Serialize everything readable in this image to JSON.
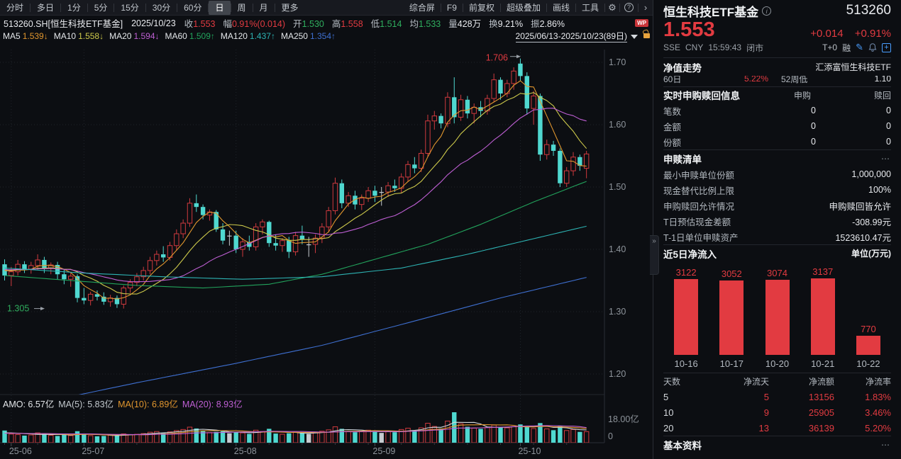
{
  "accent_colors": {
    "red": "#e23b41",
    "green": "#2fae5e",
    "cyan": "#4fd8d0",
    "candle_red": "#cf3a3e",
    "white": "#e8eaee",
    "gray": "#9aa0a7"
  },
  "toolbar": {
    "tabs": [
      {
        "label": "分时",
        "active": false
      },
      {
        "label": "多日",
        "active": false
      },
      {
        "label": "1分",
        "active": false
      },
      {
        "label": "5分",
        "active": false
      },
      {
        "label": "15分",
        "active": false
      },
      {
        "label": "30分",
        "active": false
      },
      {
        "label": "60分",
        "active": false
      },
      {
        "label": "日",
        "active": true
      },
      {
        "label": "周",
        "active": false
      },
      {
        "label": "月",
        "active": false
      },
      {
        "label": "更多",
        "active": false
      }
    ],
    "tools": [
      "综合屏",
      "F9",
      "前复权",
      "超级叠加",
      "画线",
      "工具"
    ],
    "gear_icon": "⚙",
    "help_icon": "?",
    "chevron_icon": "›"
  },
  "info_bar": {
    "symbol": "513260.SH[恒生科技ETF基金]",
    "date": "2025/10/23",
    "fields": [
      {
        "label": "收",
        "value": "1.553",
        "color": "red"
      },
      {
        "label": "幅",
        "value": "0.91%(0.014)",
        "color": "red"
      },
      {
        "label": "开",
        "value": "1.530",
        "color": "green"
      },
      {
        "label": "高",
        "value": "1.558",
        "color": "red"
      },
      {
        "label": "低",
        "value": "1.514",
        "color": "green"
      },
      {
        "label": "均",
        "value": "1.533",
        "color": "green"
      },
      {
        "label": "量",
        "value": "428万",
        "color": "white"
      },
      {
        "label": "换",
        "value": "9.21%",
        "color": "white"
      },
      {
        "label": "振",
        "value": "2.86%",
        "color": "white"
      }
    ],
    "wp_badge": "WP"
  },
  "ma_legend": [
    {
      "name": "MA5",
      "value": "1.539",
      "arrow": "↓",
      "color": "#e0962e"
    },
    {
      "name": "MA10",
      "value": "1.558",
      "arrow": "↓",
      "color": "#cdc94b"
    },
    {
      "name": "MA20",
      "value": "1.594",
      "arrow": "↓",
      "color": "#bf5fd4"
    },
    {
      "name": "MA60",
      "value": "1.509",
      "arrow": "↑",
      "color": "#22a35c"
    },
    {
      "name": "MA120",
      "value": "1.437",
      "arrow": "↑",
      "color": "#2db3b3"
    },
    {
      "name": "MA250",
      "value": "1.354",
      "arrow": "↑",
      "color": "#3e6fd0"
    }
  ],
  "range_label": "2025/06/13-2025/10/23(89日)",
  "volume_legend": [
    {
      "text": "AMO: 6.57亿",
      "color": "#e4e7ea"
    },
    {
      "text": "MA(5): 5.83亿",
      "color": "#c3c9ce"
    },
    {
      "text": "MA(10): 6.89亿",
      "color": "#e0962e"
    },
    {
      "text": "MA(20): 8.93亿",
      "color": "#bf5fd4"
    }
  ],
  "chart_data": {
    "type": "candlestick_volume",
    "title": "513260.SH 恒生科技ETF基金 日K 2025/06/13-2025/10/23",
    "y_ticks": [
      "1.70",
      "1.60",
      "1.50",
      "1.40",
      "1.30",
      "1.20"
    ],
    "x_ticks": [
      {
        "label": "25-06",
        "i": 1
      },
      {
        "label": "25-07",
        "i": 12
      },
      {
        "label": "25-08",
        "i": 35
      },
      {
        "label": "25-09",
        "i": 56
      },
      {
        "label": "25-10",
        "i": 78
      }
    ],
    "vol_axis": {
      "top": "18.00亿",
      "zero": "0",
      "max": 18
    },
    "annotations": {
      "high_label": "1.706",
      "high_value": 1.706,
      "low_label": "1.305",
      "low_value": 1.305
    },
    "ma_short": [
      {
        "n": 5,
        "color": "#e0962e"
      },
      {
        "n": 10,
        "color": "#cdc94b"
      },
      {
        "n": 20,
        "color": "#bf5fd4"
      }
    ],
    "ma_long": [
      {
        "name": "MA60",
        "color": "#22a35c",
        "points": [
          [
            0,
            1.358
          ],
          [
            10,
            1.35
          ],
          [
            20,
            1.342
          ],
          [
            30,
            1.338
          ],
          [
            40,
            1.344
          ],
          [
            48,
            1.36
          ],
          [
            56,
            1.384
          ],
          [
            64,
            1.408
          ],
          [
            72,
            1.44
          ],
          [
            80,
            1.476
          ],
          [
            88,
            1.509
          ]
        ]
      },
      {
        "name": "MA120",
        "color": "#2db3b3",
        "points": [
          [
            0,
            1.37
          ],
          [
            12,
            1.362
          ],
          [
            24,
            1.356
          ],
          [
            36,
            1.352
          ],
          [
            48,
            1.356
          ],
          [
            60,
            1.37
          ],
          [
            70,
            1.392
          ],
          [
            78,
            1.412
          ],
          [
            88,
            1.437
          ]
        ]
      },
      {
        "name": "MA250",
        "color": "#3e6fd0",
        "points": [
          [
            6,
            1.155
          ],
          [
            20,
            1.186
          ],
          [
            34,
            1.215
          ],
          [
            48,
            1.246
          ],
          [
            62,
            1.285
          ],
          [
            75,
            1.322
          ],
          [
            88,
            1.355
          ]
        ]
      }
    ],
    "vol_ma": [
      {
        "n": 5,
        "color": "#d3d7db"
      },
      {
        "n": 10,
        "color": "#e0962e"
      },
      {
        "n": 20,
        "color": "#bf5fd4"
      }
    ],
    "candles": [
      [
        1.376,
        1.384,
        1.35,
        1.358
      ],
      [
        1.358,
        1.372,
        1.341,
        1.364
      ],
      [
        1.364,
        1.383,
        1.358,
        1.376
      ],
      [
        1.376,
        1.381,
        1.362,
        1.368
      ],
      [
        1.368,
        1.38,
        1.361,
        1.374
      ],
      [
        1.374,
        1.392,
        1.367,
        1.383
      ],
      [
        1.383,
        1.388,
        1.362,
        1.37
      ],
      [
        1.37,
        1.379,
        1.36,
        1.375
      ],
      [
        1.375,
        1.38,
        1.352,
        1.36
      ],
      [
        1.36,
        1.368,
        1.344,
        1.352
      ],
      [
        1.352,
        1.362,
        1.34,
        1.357
      ],
      [
        1.357,
        1.36,
        1.315,
        1.322
      ],
      [
        1.322,
        1.338,
        1.312,
        1.318
      ],
      [
        1.318,
        1.332,
        1.31,
        1.328
      ],
      [
        1.328,
        1.334,
        1.318,
        1.324
      ],
      [
        1.324,
        1.331,
        1.311,
        1.316
      ],
      [
        1.316,
        1.327,
        1.308,
        1.322
      ],
      [
        1.322,
        1.326,
        1.306,
        1.312
      ],
      [
        1.312,
        1.342,
        1.305,
        1.338
      ],
      [
        1.338,
        1.352,
        1.33,
        1.347
      ],
      [
        1.347,
        1.362,
        1.341,
        1.356
      ],
      [
        1.356,
        1.372,
        1.35,
        1.366
      ],
      [
        1.366,
        1.388,
        1.36,
        1.382
      ],
      [
        1.382,
        1.398,
        1.374,
        1.392
      ],
      [
        1.392,
        1.405,
        1.38,
        1.387
      ],
      [
        1.387,
        1.412,
        1.382,
        1.406
      ],
      [
        1.406,
        1.432,
        1.398,
        1.425
      ],
      [
        1.425,
        1.448,
        1.418,
        1.442
      ],
      [
        1.442,
        1.482,
        1.436,
        1.474
      ],
      [
        1.474,
        1.488,
        1.46,
        1.468
      ],
      [
        1.468,
        1.472,
        1.448,
        1.455
      ],
      [
        1.455,
        1.464,
        1.446,
        1.46
      ],
      [
        1.46,
        1.463,
        1.428,
        1.432
      ],
      [
        1.432,
        1.442,
        1.408,
        1.414
      ],
      [
        1.422,
        1.43,
        1.406,
        1.422
      ],
      [
        1.422,
        1.43,
        1.394,
        1.4
      ],
      [
        1.4,
        1.418,
        1.388,
        1.412
      ],
      [
        1.412,
        1.422,
        1.398,
        1.404
      ],
      [
        1.404,
        1.442,
        1.398,
        1.436
      ],
      [
        1.436,
        1.448,
        1.424,
        1.444
      ],
      [
        1.444,
        1.446,
        1.404,
        1.41
      ],
      [
        1.41,
        1.424,
        1.398,
        1.406
      ],
      [
        1.406,
        1.418,
        1.396,
        1.414
      ],
      [
        1.414,
        1.42,
        1.386,
        1.396
      ],
      [
        1.396,
        1.428,
        1.39,
        1.422
      ],
      [
        1.422,
        1.438,
        1.408,
        1.416
      ],
      [
        1.408,
        1.42,
        1.388,
        1.408
      ],
      [
        1.408,
        1.424,
        1.394,
        1.418
      ],
      [
        1.418,
        1.442,
        1.41,
        1.436
      ],
      [
        1.436,
        1.468,
        1.428,
        1.462
      ],
      [
        1.462,
        1.515,
        1.456,
        1.506
      ],
      [
        1.506,
        1.512,
        1.466,
        1.474
      ],
      [
        1.474,
        1.492,
        1.468,
        1.486
      ],
      [
        1.486,
        1.494,
        1.464,
        1.472
      ],
      [
        1.472,
        1.488,
        1.463,
        1.482
      ],
      [
        1.482,
        1.5,
        1.476,
        1.494
      ],
      [
        1.494,
        1.502,
        1.476,
        1.486
      ],
      [
        1.492,
        1.5,
        1.47,
        1.492
      ],
      [
        1.492,
        1.508,
        1.484,
        1.502
      ],
      [
        1.502,
        1.512,
        1.492,
        1.498
      ],
      [
        1.498,
        1.522,
        1.49,
        1.516
      ],
      [
        1.516,
        1.542,
        1.508,
        1.536
      ],
      [
        1.536,
        1.548,
        1.522,
        1.53
      ],
      [
        1.53,
        1.56,
        1.524,
        1.554
      ],
      [
        1.554,
        1.616,
        1.548,
        1.606
      ],
      [
        1.606,
        1.622,
        1.592,
        1.614
      ],
      [
        1.614,
        1.618,
        1.594,
        1.602
      ],
      [
        1.602,
        1.652,
        1.596,
        1.644
      ],
      [
        1.644,
        1.676,
        1.602,
        1.612
      ],
      [
        1.612,
        1.648,
        1.606,
        1.64
      ],
      [
        1.64,
        1.646,
        1.61,
        1.618
      ],
      [
        1.618,
        1.634,
        1.602,
        1.628
      ],
      [
        1.628,
        1.638,
        1.612,
        1.622
      ],
      [
        1.622,
        1.648,
        1.616,
        1.642
      ],
      [
        1.642,
        1.682,
        1.636,
        1.672
      ],
      [
        1.672,
        1.676,
        1.64,
        1.65
      ],
      [
        1.65,
        1.672,
        1.644,
        1.666
      ],
      [
        1.666,
        1.692,
        1.656,
        1.686
      ],
      [
        1.698,
        1.706,
        1.67,
        1.678
      ],
      [
        1.678,
        1.684,
        1.616,
        1.626
      ],
      [
        1.626,
        1.654,
        1.6,
        1.646
      ],
      [
        1.646,
        1.65,
        1.542,
        1.552
      ],
      [
        1.552,
        1.576,
        1.544,
        1.568
      ],
      [
        1.568,
        1.574,
        1.55,
        1.558
      ],
      [
        1.558,
        1.562,
        1.5,
        1.506
      ],
      [
        1.506,
        1.532,
        1.5,
        1.526
      ],
      [
        1.526,
        1.556,
        1.518,
        1.548
      ],
      [
        1.548,
        1.552,
        1.526,
        1.534
      ],
      [
        1.53,
        1.558,
        1.514,
        1.553
      ]
    ],
    "volumes": [
      7.2,
      5.1,
      4.8,
      4.2,
      4.6,
      5.8,
      5.2,
      4.4,
      4.0,
      4.6,
      4.2,
      6.8,
      5.4,
      4.2,
      3.8,
      4.0,
      4.4,
      4.6,
      5.2,
      4.8,
      5.0,
      5.4,
      6.2,
      6.6,
      5.8,
      6.4,
      7.2,
      7.8,
      9.2,
      8.4,
      7.2,
      6.0,
      6.4,
      6.8,
      5.6,
      6.2,
      5.8,
      5.2,
      7.4,
      6.6,
      8.2,
      5.4,
      5.0,
      5.6,
      6.2,
      5.8,
      5.2,
      6.0,
      6.8,
      7.6,
      9.4,
      8.2,
      6.6,
      6.2,
      6.8,
      7.4,
      6.4,
      5.8,
      6.6,
      6.2,
      7.8,
      8.6,
      7.2,
      8.8,
      11.5,
      9.6,
      8.4,
      12.8,
      18.0,
      11.2,
      9.4,
      8.6,
      8.2,
      9.0,
      10.4,
      9.2,
      8.8,
      9.6,
      10.8,
      9.8,
      8.4,
      11.6,
      8.2,
      7.4,
      9.8,
      7.2,
      7.8,
      6.4,
      6.57
    ]
  },
  "panel": {
    "header": {
      "name": "恒生科技ETF基金",
      "info_icon": "i",
      "code": "513260",
      "price": "1.553",
      "change": "+0.014",
      "change_pct": "+0.91%",
      "exchange": "SSE",
      "currency": "CNY",
      "time": "15:59:43",
      "status": "闭市",
      "tplus": "T+0",
      "margin": "融",
      "edit_icon": "✎",
      "plus_icon": "+"
    },
    "nav": {
      "title": "净值走势",
      "right": "汇添富恒生科技ETF",
      "clipped_row": {
        "l1": "60日",
        "v1": "5.22%",
        "l2": "52周低",
        "v2": "1.10"
      }
    },
    "realtime": {
      "title": "实时申购赎回信息",
      "col1": "申购",
      "col2": "赎回",
      "rows": [
        {
          "label": "笔数",
          "v1": "0",
          "v2": "0"
        },
        {
          "label": "金额",
          "v1": "0",
          "v2": "0"
        },
        {
          "label": "份额",
          "v1": "0",
          "v2": "0"
        }
      ]
    },
    "redemption": {
      "title": "申赎清单",
      "more": "⋯",
      "rows": [
        {
          "label": "最小申赎单位份额",
          "value": "1,000,000"
        },
        {
          "label": "现金替代比例上限",
          "value": "100%"
        },
        {
          "label": "申购赎回允许情况",
          "value": "申购赎回皆允许"
        },
        {
          "label": "T日预估现金差额",
          "value": "-308.99元"
        },
        {
          "label": "T-1日单位申赎资产",
          "value": "1523610.47元"
        }
      ]
    },
    "flows": {
      "title": "近5日净流入",
      "unit": "单位(万元)",
      "max": 3137,
      "bars": [
        {
          "date": "10-16",
          "value": 3122
        },
        {
          "date": "10-17",
          "value": 3052
        },
        {
          "date": "10-20",
          "value": 3074
        },
        {
          "date": "10-21",
          "value": 3137
        },
        {
          "date": "10-22",
          "value": 770
        }
      ]
    },
    "flow_table": {
      "headers": [
        "天数",
        "净流天",
        "净流额",
        "净流率"
      ],
      "rows": [
        [
          "5",
          "5",
          "13156",
          "1.83%"
        ],
        [
          "10",
          "9",
          "25905",
          "3.46%"
        ],
        [
          "20",
          "13",
          "36139",
          "5.20%"
        ]
      ]
    },
    "basic": {
      "title": "基本资料",
      "more": "⋯"
    },
    "handle_icon": "»"
  }
}
